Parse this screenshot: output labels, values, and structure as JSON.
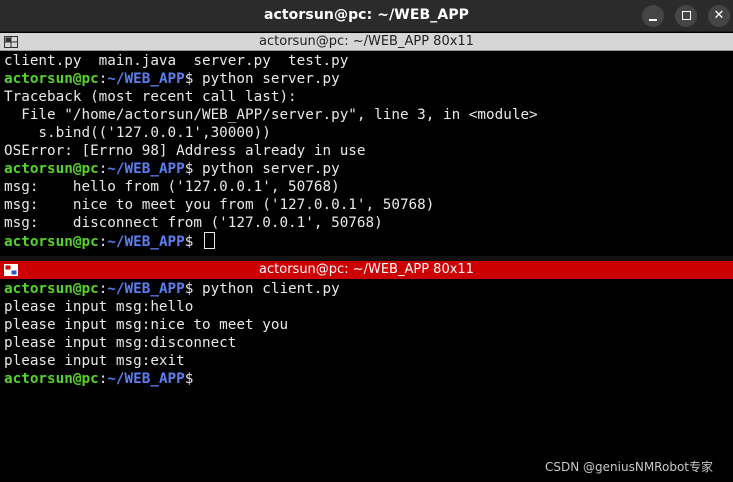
{
  "window": {
    "title": "actorsun@pc: ~/WEB_APP",
    "buttons": {
      "minimize": "—",
      "maximize": "□",
      "close": "✕"
    }
  },
  "top_pane": {
    "title": "actorsun@pc: ~/WEB_APP 80x11",
    "lines": [
      {
        "text": "client.py  main.java  server.py  test.py"
      },
      {
        "user": "actorsun@pc",
        "sep": ":",
        "path": "~/WEB_APP",
        "prompt": "$ ",
        "cmd": "python server.py"
      },
      {
        "text": "Traceback (most recent call last):"
      },
      {
        "text": "  File \"/home/actorsun/WEB_APP/server.py\", line 3, in <module>"
      },
      {
        "text": "    s.bind(('127.0.0.1',30000))"
      },
      {
        "text": "OSError: [Errno 98] Address already in use"
      },
      {
        "user": "actorsun@pc",
        "sep": ":",
        "path": "~/WEB_APP",
        "prompt": "$ ",
        "cmd": "python server.py"
      },
      {
        "text": "msg:    hello from ('127.0.0.1', 50768)"
      },
      {
        "text": "msg:    nice to meet you from ('127.0.0.1', 50768)"
      },
      {
        "text": "msg:    disconnect from ('127.0.0.1', 50768)"
      },
      {
        "user": "actorsun@pc",
        "sep": ":",
        "path": "~/WEB_APP",
        "prompt": "$ ",
        "cmd": ""
      }
    ]
  },
  "bottom_pane": {
    "title": "actorsun@pc: ~/WEB_APP 80x11",
    "lines": [
      {
        "user": "actorsun@pc",
        "sep": ":",
        "path": "~/WEB_APP",
        "prompt": "$ ",
        "cmd": "python client.py"
      },
      {
        "text": "please input msg:hello"
      },
      {
        "text": "please input msg:nice to meet you"
      },
      {
        "text": "please input msg:disconnect"
      },
      {
        "text": "please input msg:exit"
      },
      {
        "user": "actorsun@pc",
        "sep": ":",
        "path": "~/WEB_APP",
        "prompt": "$",
        "cmd": ""
      }
    ]
  },
  "colors": {
    "prompt_user": "#55d42b",
    "prompt_path": "#5b7ef0",
    "active_header": "#cc0000",
    "inactive_header": "#d6d6d6"
  },
  "icons": {
    "pane_icon_top": "terminal-split-icon",
    "pane_icon_bottom": "terminal-split-icon-active"
  },
  "watermark": "CSDN @geniusNMRobot专家"
}
